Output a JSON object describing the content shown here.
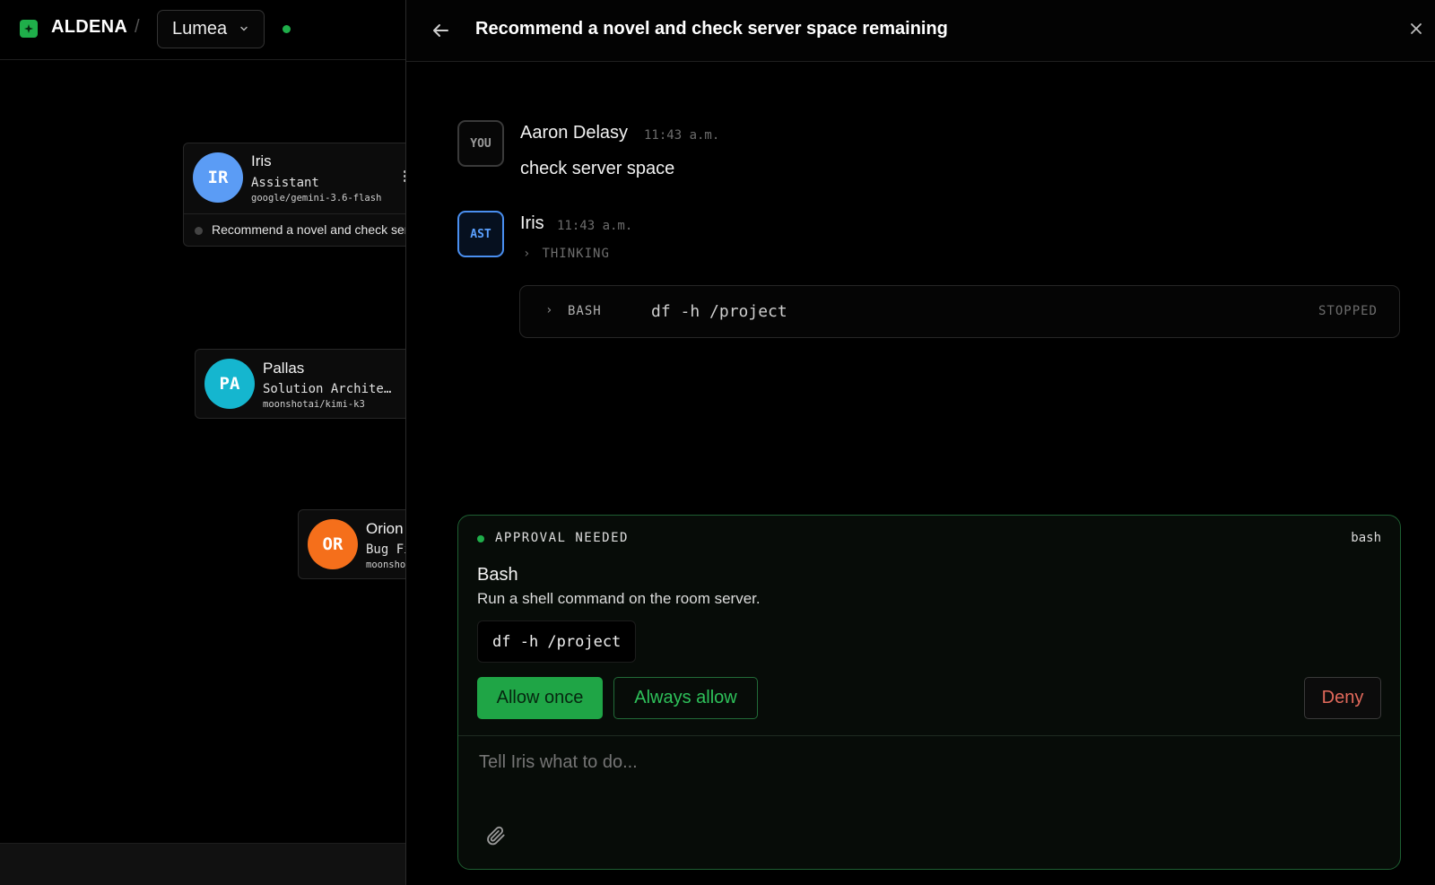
{
  "header": {
    "brand": "ALDENA",
    "separator": "/",
    "room": "Lumea",
    "status_color": "#1fae4a"
  },
  "agents": [
    {
      "initials": "IR",
      "name": "Iris",
      "role": "Assistant",
      "model": "google/gemini-3.6-flash",
      "color": "#5b9cf5",
      "task": "Recommend a novel and check server space remaining"
    },
    {
      "initials": "PA",
      "name": "Pallas",
      "role": "Solution Archite…",
      "model": "moonshotai/kimi-k3",
      "color": "#15b6cf"
    },
    {
      "initials": "OR",
      "name": "Orion",
      "role": "Bug Fi",
      "model": "moonsho",
      "color": "#f56f1b"
    }
  ],
  "panel": {
    "title": "Recommend a novel and check server space remaining"
  },
  "messages": [
    {
      "avatar": "YOU",
      "author": "Aaron Delasy",
      "time": "11:43 a.m.",
      "text": "check server space"
    },
    {
      "avatar": "AST",
      "author": "Iris",
      "time": "11:43 a.m.",
      "thinking": "THINKING"
    }
  ],
  "tool_call": {
    "caret": "›",
    "name": "BASH",
    "command": "df -h /project",
    "status": "STOPPED"
  },
  "approval": {
    "label": "APPROVAL NEEDED",
    "tool": "bash",
    "title": "Bash",
    "description": "Run a shell command on the room server.",
    "command": "df -h /project",
    "allow_once": "Allow once",
    "always_allow": "Always allow",
    "deny": "Deny"
  },
  "composer": {
    "placeholder": "Tell Iris what to do..."
  },
  "icons": {
    "back": "arrow-left-icon",
    "close": "close-icon",
    "attach": "paperclip-icon",
    "room_chevron": "chevron-down-icon",
    "logo": "aldena-logo-icon"
  },
  "colors": {
    "accent": "#1fae4a",
    "deny": "#e2695b",
    "assistant": "#4a8ff0"
  }
}
